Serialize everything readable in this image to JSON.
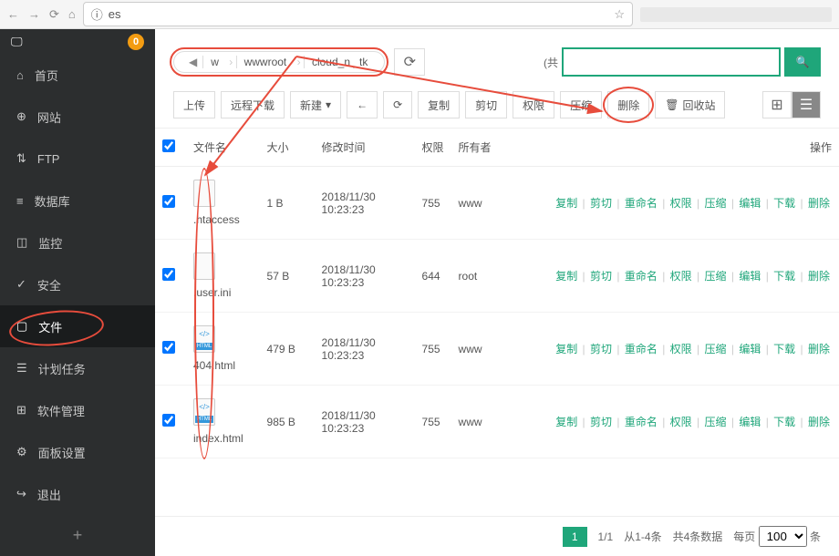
{
  "browser": {
    "url": "es"
  },
  "sidebar": {
    "badge": "0",
    "items": [
      {
        "icon": "⌂",
        "label": "首页"
      },
      {
        "icon": "⊕",
        "label": "网站"
      },
      {
        "icon": "⇅",
        "label": "FTP"
      },
      {
        "icon": "≡",
        "label": "数据库"
      },
      {
        "icon": "◫",
        "label": "监控"
      },
      {
        "icon": "✓",
        "label": "安全"
      },
      {
        "icon": "▢",
        "label": "文件",
        "active": true,
        "circled": true
      },
      {
        "icon": "☰",
        "label": "计划任务"
      },
      {
        "icon": "⊞",
        "label": "软件管理"
      },
      {
        "icon": "⚙",
        "label": "面板设置"
      },
      {
        "icon": "↪",
        "label": "退出"
      }
    ]
  },
  "breadcrumb": [
    "w",
    "wwwroot",
    "cloud_n        _tk"
  ],
  "search": {
    "prefix": "(共",
    "placeholder": ""
  },
  "toolbar": {
    "upload": "上传",
    "remote": "远程下载",
    "new": "新建",
    "back": "←",
    "refresh": "⟳",
    "copy": "复制",
    "cut": "剪切",
    "perm": "权限",
    "zip": "压缩",
    "delete": "删除",
    "trash": "回收站"
  },
  "headers": {
    "name": "文件名",
    "size": "大小",
    "time": "修改时间",
    "perm": "权限",
    "owner": "所有者",
    "ops": "操作"
  },
  "ops_labels": [
    "复制",
    "剪切",
    "重命名",
    "权限",
    "压缩",
    "编辑",
    "下载",
    "删除"
  ],
  "rows": [
    {
      "name": ".htaccess",
      "size": "1 B",
      "time": "2018/11/30 10:23:23",
      "perm": "755",
      "owner": "www",
      "html": false
    },
    {
      "name": ".user.ini",
      "size": "57 B",
      "time": "2018/11/30 10:23:23",
      "perm": "644",
      "owner": "root",
      "html": false
    },
    {
      "name": "404.html",
      "size": "479 B",
      "time": "2018/11/30 10:23:23",
      "perm": "755",
      "owner": "www",
      "html": true
    },
    {
      "name": "index.html",
      "size": "985 B",
      "time": "2018/11/30 10:23:23",
      "perm": "755",
      "owner": "www",
      "html": true
    }
  ],
  "footer": {
    "page": "1",
    "pages": "1/1",
    "range": "从1-4条",
    "total": "共4条数据",
    "per_label": "每页",
    "per_value": "100",
    "per_suffix": "条"
  }
}
